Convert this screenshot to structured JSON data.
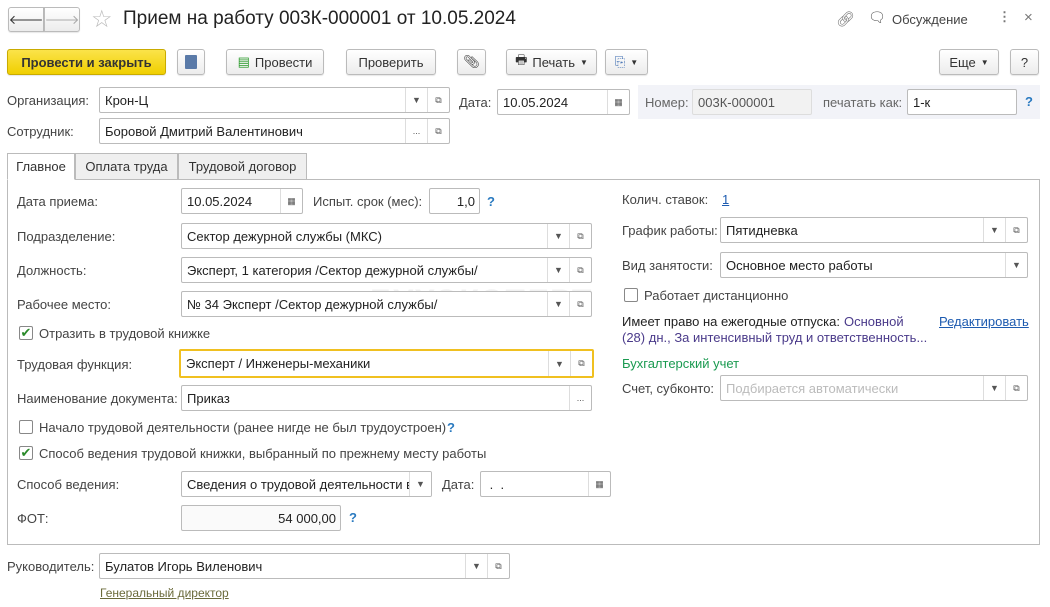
{
  "title": "Прием на работу 003К-000001 от 10.05.2024",
  "header": {
    "discussion": "Обсуждение",
    "close": "×"
  },
  "toolbar": {
    "post_close": "Провести и закрыть",
    "post": "Провести",
    "check": "Проверить",
    "print": "Печать",
    "more": "Еще",
    "help": "?"
  },
  "header_fields": {
    "org_label": "Организация:",
    "org": "Крон-Ц",
    "date_label": "Дата:",
    "date": "10.05.2024",
    "number_label": "Номер:",
    "number": "003К-000001",
    "print_as_label": "печатать как:",
    "print_as": "1-к",
    "employee_label": "Сотрудник:",
    "employee": "Боровой Дмитрий Валентинович"
  },
  "tabs": [
    "Главное",
    "Оплата труда",
    "Трудовой договор"
  ],
  "main": {
    "hire_date_label": "Дата приема:",
    "hire_date": "10.05.2024",
    "probation_label": "Испыт. срок (мес):",
    "probation": "1,0",
    "dept_label": "Подразделение:",
    "dept": "Сектор дежурной службы (МКС)",
    "position_label": "Должность:",
    "position": "Эксперт, 1 категория /Сектор дежурной службы/",
    "workplace_label": "Рабочее место:",
    "workplace": "№ 34 Эксперт /Сектор дежурной службы/",
    "reflect_label": "Отразить в трудовой книжке",
    "reflect": true,
    "function_label": "Трудовая функция:",
    "function": "Эксперт / Инженеры-механики",
    "docname_label": "Наименование документа:",
    "docname": "Приказ",
    "start_label": "Начало трудовой деятельности (ранее нигде не был трудоустроен)",
    "start": false,
    "method_prev_label": "Способ ведения трудовой книжки, выбранный по прежнему месту работы",
    "method_prev": true,
    "method_label": "Способ ведения:",
    "method": "Сведения о трудовой деятельности в",
    "method_date_label": "Дата:",
    "method_date": " .  .",
    "fot_label": "ФОТ:",
    "fot": "54 000,00",
    "rates_label": "Колич. ставок:",
    "rates": "1",
    "schedule_label": "График работы:",
    "schedule": "Пятидневка",
    "employment_label": "Вид занятости:",
    "employment": "Основное место работы",
    "remote_label": "Работает дистанционно",
    "remote": false,
    "vacation_label": "Имеет право на ежегодные отпуска:",
    "vacation_line1": "Основной",
    "vacation_line2": "(28) дн., За интенсивный труд и ответственность...",
    "edit": "Редактировать",
    "accounting_title": "Бухгалтерский учет",
    "account_label": "Счет, субконто:",
    "account_placeholder": "Подбирается автоматически"
  },
  "footer": {
    "manager_label": "Руководитель:",
    "manager": "Булатов Игорь Виленович",
    "manager_position": "Генеральный директор"
  },
  "watermark": "БУХЭКСПЕРТ",
  "colors": {
    "primary_button": "#f5d800",
    "accent": "#1d5bb0",
    "green": "#1a9a50",
    "focus": "#f0c020"
  }
}
